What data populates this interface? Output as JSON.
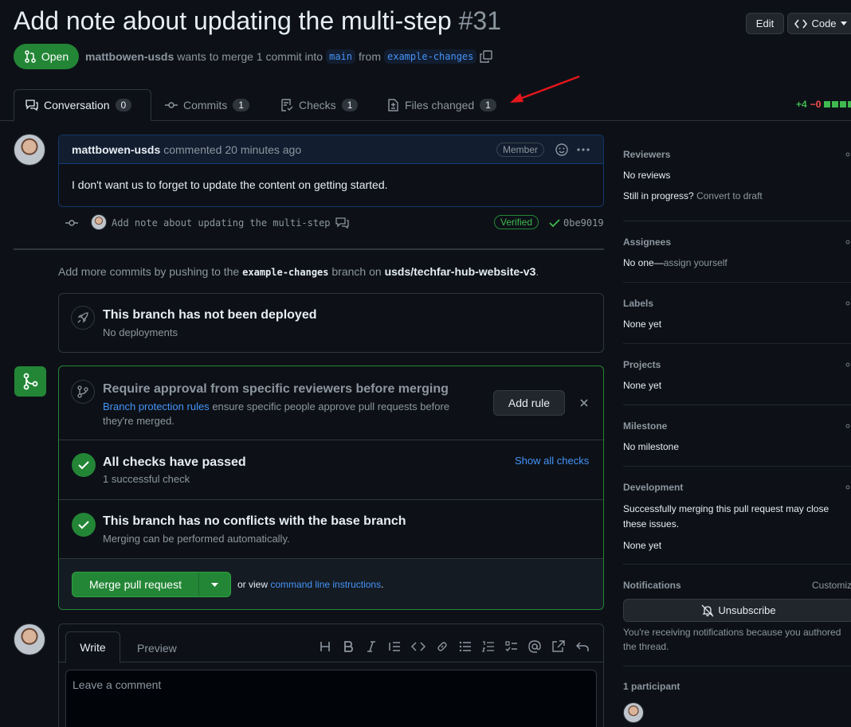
{
  "header": {
    "title": "Add note about updating the multi-step",
    "number": "#31",
    "edit_label": "Edit",
    "code_label": "Code"
  },
  "status": {
    "badge": "Open",
    "author": "mattbowen-usds",
    "text_mid": "wants to merge 1 commit into",
    "base_branch": "main",
    "text_from": "from",
    "head_branch": "example-changes"
  },
  "tabs": [
    {
      "label": "Conversation",
      "count": "0"
    },
    {
      "label": "Commits",
      "count": "1"
    },
    {
      "label": "Checks",
      "count": "1"
    },
    {
      "label": "Files changed",
      "count": "1"
    }
  ],
  "diffstat": {
    "added": "+4",
    "removed": "−0"
  },
  "comment": {
    "author": "mattbowen-usds",
    "action": "commented",
    "time": "20 minutes ago",
    "role": "Member",
    "body": "I don't want us to forget to update the content on getting started."
  },
  "commit": {
    "message": "Add note about updating the multi-step",
    "verified": "Verified",
    "sha": "0be9019"
  },
  "push_hint": {
    "prefix": "Add more commits by pushing to the",
    "branch": "example-changes",
    "middle": "branch on",
    "repo": "usds/techfar-hub-website-v3",
    "suffix": "."
  },
  "deploy": {
    "title": "This branch has not been deployed",
    "subtitle": "No deployments"
  },
  "merge": {
    "rule_title": "Require approval from specific reviewers before merging",
    "rule_link": "Branch protection rules",
    "rule_text": "ensure specific people approve pull requests before they're merged.",
    "add_rule": "Add rule",
    "checks_title": "All checks have passed",
    "checks_sub": "1 successful check",
    "show_checks": "Show all checks",
    "conflicts_title": "This branch has no conflicts with the base branch",
    "conflicts_sub": "Merging can be performed automatically.",
    "merge_button": "Merge pull request",
    "or_view": "or view",
    "cli_link": "command line instructions",
    "cli_suffix": "."
  },
  "editor": {
    "write_tab": "Write",
    "preview_tab": "Preview",
    "placeholder": "Leave a comment",
    "toolbar": [
      "heading-icon",
      "bold-icon",
      "italic-icon",
      "quote-icon",
      "code-icon",
      "link-icon",
      "bulleted-list-icon",
      "numbered-list-icon",
      "task-list-icon",
      "mention-icon",
      "reference-icon",
      "undo-icon"
    ]
  },
  "sidebar": {
    "reviewers": {
      "title": "Reviewers",
      "line1": "No reviews",
      "line2_prefix": "Still in progress?",
      "line2_link": "Convert to draft"
    },
    "assignees": {
      "title": "Assignees",
      "prefix": "No one—",
      "link": "assign yourself"
    },
    "labels": {
      "title": "Labels",
      "value": "None yet"
    },
    "projects": {
      "title": "Projects",
      "value": "None yet"
    },
    "milestone": {
      "title": "Milestone",
      "value": "No milestone"
    },
    "development": {
      "title": "Development",
      "text": "Successfully merging this pull request may close these issues.",
      "value": "None yet"
    },
    "notifications": {
      "title": "Notifications",
      "customize": "Customiz",
      "button": "Unsubscribe",
      "text": "You're receiving notifications because you authored the thread."
    },
    "participants": {
      "title": "1 participant"
    }
  },
  "colors": {
    "accent": "#4493f8",
    "success": "#238636",
    "annotation_arrow": "#e5161b"
  }
}
